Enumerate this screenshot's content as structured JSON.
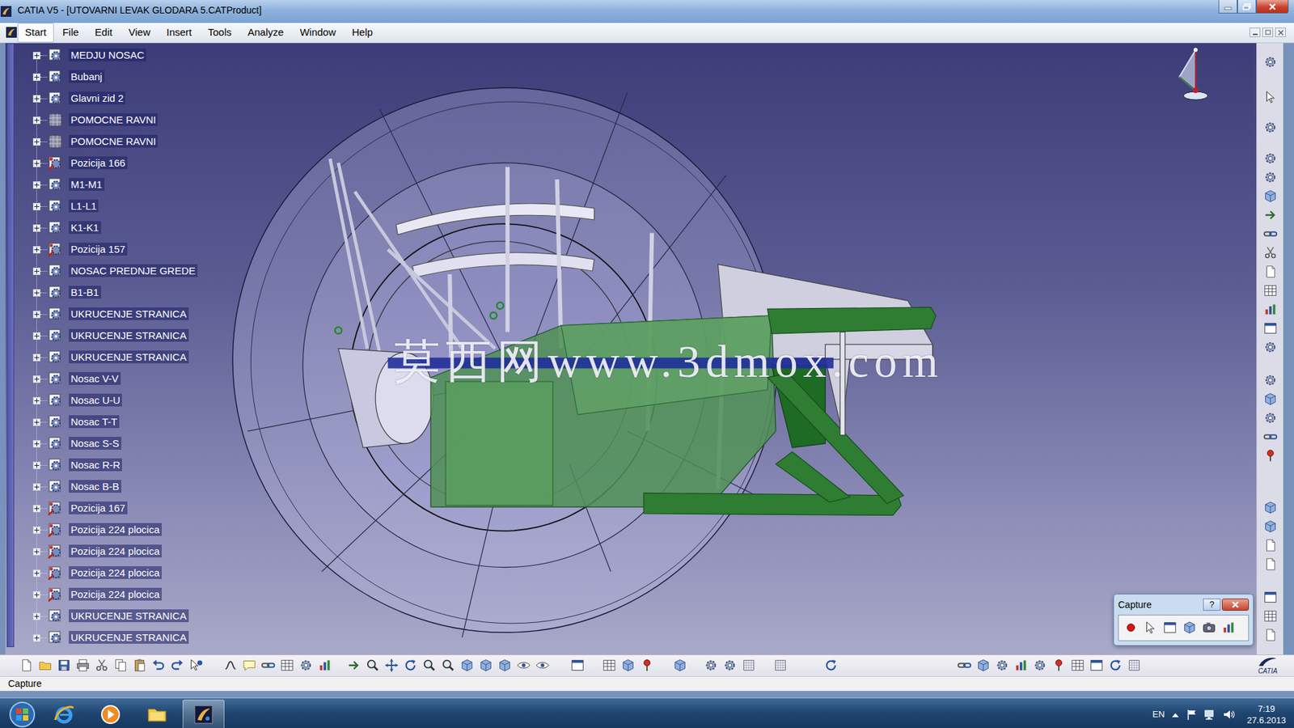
{
  "window": {
    "title": "CATIA V5 - [UTOVARNI LEVAK GLODARA 5.CATProduct]"
  },
  "menu": [
    {
      "label": "Start",
      "selected": true
    },
    {
      "label": "File",
      "selected": false
    },
    {
      "label": "Edit",
      "selected": false
    },
    {
      "label": "View",
      "selected": false
    },
    {
      "label": "Insert",
      "selected": false
    },
    {
      "label": "Tools",
      "selected": false
    },
    {
      "label": "Analyze",
      "selected": false
    },
    {
      "label": "Window",
      "selected": false
    },
    {
      "label": "Help",
      "selected": false
    }
  ],
  "tree": {
    "items": [
      {
        "label": "MEDJU NOSAC",
        "expanded": false,
        "kind": "component"
      },
      {
        "label": "Bubanj",
        "expanded": false,
        "kind": "component"
      },
      {
        "label": "Glavni zid 2",
        "expanded": false,
        "kind": "component"
      },
      {
        "label": "POMOCNE RAVNI",
        "expanded": false,
        "kind": "planes"
      },
      {
        "label": "POMOCNE RAVNI",
        "expanded": false,
        "kind": "planes"
      },
      {
        "label": "Pozicija 166",
        "expanded": false,
        "kind": "position"
      },
      {
        "label": "M1-M1",
        "expanded": false,
        "kind": "component"
      },
      {
        "label": "L1-L1",
        "expanded": false,
        "kind": "component"
      },
      {
        "label": "K1-K1",
        "expanded": false,
        "kind": "component"
      },
      {
        "label": "Pozicija 157",
        "expanded": false,
        "kind": "position"
      },
      {
        "label": "NOSAC PREDNJE GREDE",
        "expanded": false,
        "kind": "component"
      },
      {
        "label": "B1-B1",
        "expanded": false,
        "kind": "component"
      },
      {
        "label": "UKRUCENJE STRANICA",
        "expanded": false,
        "kind": "component"
      },
      {
        "label": "UKRUCENJE STRANICA",
        "expanded": false,
        "kind": "component"
      },
      {
        "label": "UKRUCENJE STRANICA",
        "expanded": false,
        "kind": "component"
      },
      {
        "label": "Nosac V-V",
        "expanded": false,
        "kind": "component"
      },
      {
        "label": "Nosac U-U",
        "expanded": false,
        "kind": "component"
      },
      {
        "label": "Nosac T-T",
        "expanded": false,
        "kind": "component"
      },
      {
        "label": "Nosac S-S",
        "expanded": false,
        "kind": "component"
      },
      {
        "label": "Nosac R-R",
        "expanded": false,
        "kind": "component"
      },
      {
        "label": "Nosac B-B",
        "expanded": false,
        "kind": "component"
      },
      {
        "label": "Pozicija 167",
        "expanded": false,
        "kind": "position"
      },
      {
        "label": "Pozicija 224 plocica",
        "expanded": false,
        "kind": "position"
      },
      {
        "label": "Pozicija 224 plocica",
        "expanded": false,
        "kind": "position"
      },
      {
        "label": "Pozicija 224 plocica",
        "expanded": false,
        "kind": "position"
      },
      {
        "label": "Pozicija 224 plocica",
        "expanded": false,
        "kind": "position"
      },
      {
        "label": "UKRUCENJE STRANICA",
        "expanded": false,
        "kind": "component"
      },
      {
        "label": "UKRUCENJE STRANICA",
        "expanded": false,
        "kind": "component"
      }
    ]
  },
  "viewport": {
    "watermark": "莫西网www.3dmox.com"
  },
  "capture": {
    "title": "Capture",
    "help": "?"
  },
  "logo": {
    "text": "CATIA"
  },
  "status_bar": {
    "text": "Capture"
  },
  "taskbar": {
    "language": "EN",
    "time": "7:19",
    "date": "27.6.2013"
  }
}
